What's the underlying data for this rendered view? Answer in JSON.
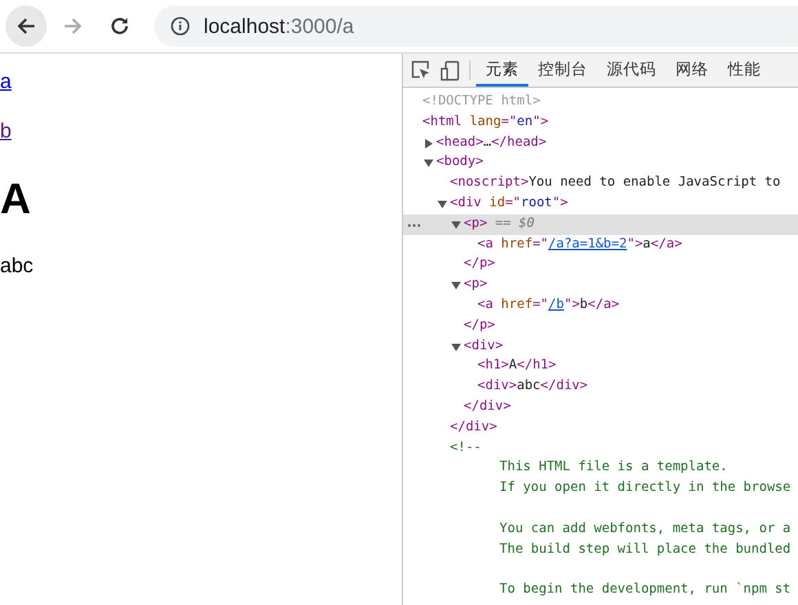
{
  "browser": {
    "url_host": "localhost",
    "url_path": ":3000/a"
  },
  "page": {
    "links": [
      {
        "text": "a",
        "visited": false
      },
      {
        "text": "b",
        "visited": true
      }
    ],
    "heading": "A",
    "text": "abc"
  },
  "devtools": {
    "tabs": [
      {
        "label": "元素",
        "selected": true
      },
      {
        "label": "控制台",
        "selected": false
      },
      {
        "label": "源代码",
        "selected": false
      },
      {
        "label": "网络",
        "selected": false
      },
      {
        "label": "性能",
        "selected": false
      }
    ],
    "dom_tree": [
      {
        "kind": "node",
        "tokens": [
          {
            "text": "<!DOCTYPE html>",
            "kind": "doctype"
          }
        ]
      },
      {
        "kind": "node",
        "tokens": [
          {
            "text": "<html ",
            "kind": "tag"
          },
          {
            "text": "lang",
            "kind": "attr"
          },
          {
            "text": "=\"",
            "kind": "tag"
          },
          {
            "text": "en",
            "kind": "value"
          },
          {
            "text": "\">",
            "kind": "tag"
          }
        ],
        "children": [
          {
            "kind": "node",
            "expanded": false,
            "tokens": [
              {
                "text": "<head>",
                "kind": "tag"
              },
              {
                "text": "…",
                "kind": "text"
              },
              {
                "text": "</head>",
                "kind": "tag"
              }
            ]
          },
          {
            "kind": "node",
            "expanded": true,
            "tokens": [
              {
                "text": "<body>",
                "kind": "tag"
              }
            ],
            "children": [
              {
                "kind": "node",
                "tokens": [
                  {
                    "text": "<noscript>",
                    "kind": "tag"
                  },
                  {
                    "text": "You need to enable JavaScript to",
                    "kind": "text"
                  }
                ]
              },
              {
                "kind": "node",
                "expanded": true,
                "tokens": [
                  {
                    "text": "<div ",
                    "kind": "tag"
                  },
                  {
                    "text": "id",
                    "kind": "attr"
                  },
                  {
                    "text": "=\"",
                    "kind": "tag"
                  },
                  {
                    "text": "root",
                    "kind": "value"
                  },
                  {
                    "text": "\">",
                    "kind": "tag"
                  }
                ],
                "children": [
                  {
                    "kind": "node",
                    "expanded": true,
                    "selected": true,
                    "tokens": [
                      {
                        "text": "<p>",
                        "kind": "tag"
                      },
                      {
                        "text": " == $0",
                        "kind": "hint"
                      }
                    ],
                    "children": [
                      {
                        "kind": "node",
                        "tokens": [
                          {
                            "text": "<a ",
                            "kind": "tag"
                          },
                          {
                            "text": "href",
                            "kind": "attr"
                          },
                          {
                            "text": "=\"",
                            "kind": "tag"
                          },
                          {
                            "text": "/a?a=1&b=2",
                            "kind": "link"
                          },
                          {
                            "text": "\">",
                            "kind": "tag"
                          },
                          {
                            "text": "a",
                            "kind": "text"
                          },
                          {
                            "text": "</a>",
                            "kind": "tag"
                          }
                        ]
                      }
                    ],
                    "close": [
                      {
                        "text": "</p>",
                        "kind": "tag"
                      }
                    ]
                  },
                  {
                    "kind": "node",
                    "expanded": true,
                    "selected": false,
                    "tokens": [
                      {
                        "text": "<p>",
                        "kind": "tag"
                      }
                    ],
                    "children": [
                      {
                        "kind": "node",
                        "tokens": [
                          {
                            "text": "<a ",
                            "kind": "tag"
                          },
                          {
                            "text": "href",
                            "kind": "attr"
                          },
                          {
                            "text": "=\"",
                            "kind": "tag"
                          },
                          {
                            "text": "/b",
                            "kind": "link"
                          },
                          {
                            "text": "\">",
                            "kind": "tag"
                          },
                          {
                            "text": "b",
                            "kind": "text"
                          },
                          {
                            "text": "</a>",
                            "kind": "tag"
                          }
                        ]
                      }
                    ],
                    "close": [
                      {
                        "text": "</p>",
                        "kind": "tag"
                      }
                    ]
                  },
                  {
                    "kind": "node",
                    "expanded": true,
                    "tokens": [
                      {
                        "text": "<div>",
                        "kind": "tag"
                      }
                    ],
                    "children": [
                      {
                        "kind": "node",
                        "tokens": [
                          {
                            "text": "<h1>",
                            "kind": "tag"
                          },
                          {
                            "text": "A",
                            "kind": "text"
                          },
                          {
                            "text": "</h1>",
                            "kind": "tag"
                          }
                        ]
                      },
                      {
                        "kind": "node",
                        "tokens": [
                          {
                            "text": "<div>",
                            "kind": "tag"
                          },
                          {
                            "text": "abc",
                            "kind": "text"
                          },
                          {
                            "text": "</div>",
                            "kind": "tag"
                          }
                        ]
                      }
                    ],
                    "close": [
                      {
                        "text": "</div>",
                        "kind": "tag"
                      }
                    ]
                  }
                ],
                "close": [
                  {
                    "text": "</div>",
                    "kind": "tag"
                  }
                ]
              },
              {
                "kind": "comment",
                "tokens": [
                  {
                    "text": "<!--",
                    "kind": "comment"
                  }
                ],
                "paragraphs": [
                  [
                    "This HTML file is a template.",
                    "If you open it directly in the browse"
                  ],
                  [
                    "You can add webfonts, meta tags, or a",
                    "The build step will place the bundled"
                  ],
                  [
                    "To begin the development, run `npm st"
                  ]
                ]
              }
            ]
          }
        ]
      }
    ]
  }
}
